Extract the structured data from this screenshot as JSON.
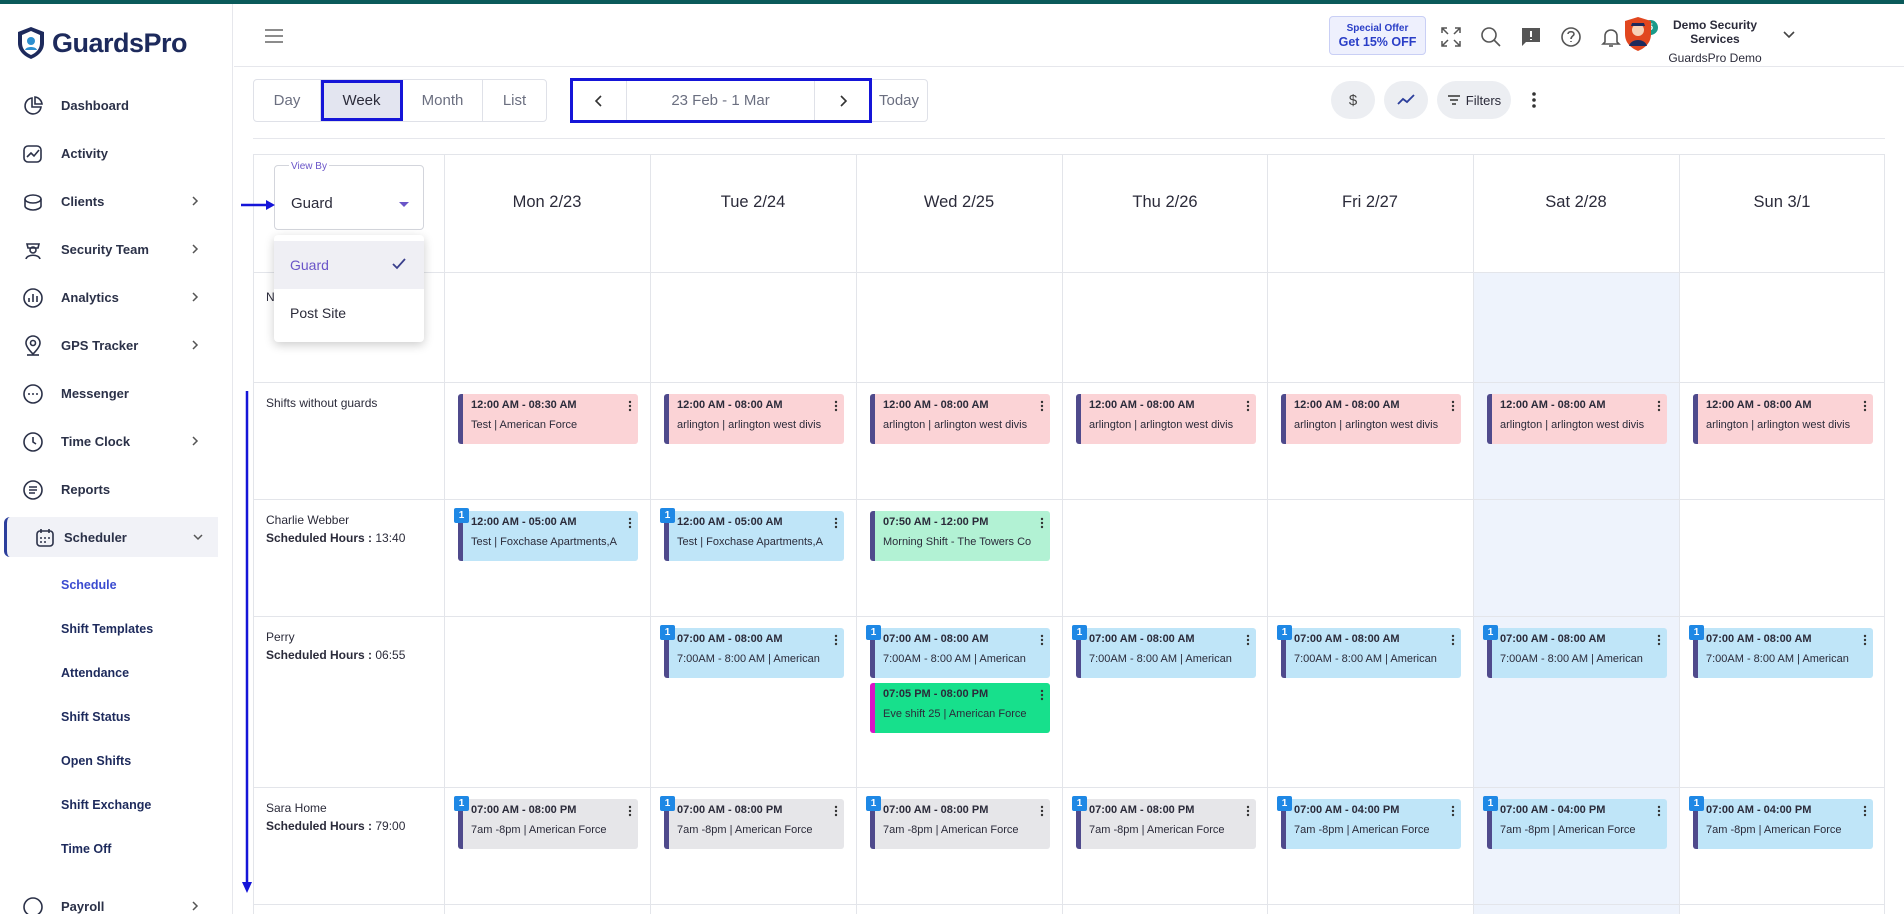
{
  "app": {
    "brand": "GuardsPro"
  },
  "sidebar": {
    "items": [
      {
        "label": "Dashboard"
      },
      {
        "label": "Activity"
      },
      {
        "label": "Clients"
      },
      {
        "label": "Security Team"
      },
      {
        "label": "Analytics"
      },
      {
        "label": "GPS Tracker"
      },
      {
        "label": "Messenger"
      },
      {
        "label": "Time Clock"
      },
      {
        "label": "Reports"
      },
      {
        "label": "Scheduler"
      },
      {
        "label": "Payroll"
      }
    ],
    "scheduler_sub": [
      {
        "label": "Schedule"
      },
      {
        "label": "Shift Templates"
      },
      {
        "label": "Attendance"
      },
      {
        "label": "Shift Status"
      },
      {
        "label": "Open Shifts"
      },
      {
        "label": "Shift Exchange"
      },
      {
        "label": "Time Off"
      }
    ]
  },
  "header": {
    "offer_line1": "Special Offer",
    "offer_line2": "Get 15% OFF",
    "notification_count": "5",
    "company_name": "Demo Security Services",
    "user_name": "GuardsPro Demo"
  },
  "toolbar": {
    "views": [
      "Day",
      "Week",
      "Month",
      "List"
    ],
    "active_view": "Week",
    "date_range": "23 Feb - 1 Mar",
    "today_label": "Today",
    "dollar_label": "$",
    "filters_label": "Filters"
  },
  "view_by": {
    "label": "View By",
    "value": "Guard",
    "options": [
      "Guard",
      "Post Site"
    ]
  },
  "grid": {
    "days": [
      "Mon 2/23",
      "Tue 2/24",
      "Wed 2/25",
      "Thu 2/26",
      "Fri 2/27",
      "Sat 2/28",
      "Sun 3/1"
    ],
    "hidden_row_stub": "N",
    "rows": [
      {
        "name": "Shifts without guards",
        "hours_label": "",
        "hours": ""
      },
      {
        "name": "Charlie Webber",
        "hours_label": "Scheduled Hours :",
        "hours": "13:40"
      },
      {
        "name": "Perry",
        "hours_label": "Scheduled Hours :",
        "hours": "06:55"
      },
      {
        "name": "Sara Home",
        "hours_label": "Scheduled Hours :",
        "hours": "79:00"
      }
    ],
    "shifts": {
      "unassigned": [
        {
          "time": "12:00 AM - 08:30 AM",
          "desc": "Test | American Force"
        },
        {
          "time": "12:00 AM - 08:00 AM",
          "desc": "arlington | arlington west divis"
        },
        {
          "time": "12:00 AM - 08:00 AM",
          "desc": "arlington | arlington west divis"
        },
        {
          "time": "12:00 AM - 08:00 AM",
          "desc": "arlington | arlington west divis"
        },
        {
          "time": "12:00 AM - 08:00 AM",
          "desc": "arlington | arlington west divis"
        },
        {
          "time": "12:00 AM - 08:00 AM",
          "desc": "arlington | arlington west divis"
        },
        {
          "time": "12:00 AM - 08:00 AM",
          "desc": "arlington | arlington west divis"
        }
      ],
      "charlie": [
        {
          "time": "12:00 AM - 05:00 AM",
          "desc": "Test | Foxchase Apartments,A",
          "num": "1"
        },
        {
          "time": "12:00 AM - 05:00 AM",
          "desc": "Test | Foxchase Apartments,A",
          "num": "1"
        },
        {
          "time": "07:50 AM - 12:00 PM",
          "desc": "Morning Shift - The Towers Co"
        }
      ],
      "perry": [
        {
          "time": "07:00 AM - 08:00 AM",
          "desc": "7:00AM - 8:00 AM | American",
          "num": "1"
        },
        {
          "time": "07:00 AM - 08:00 AM",
          "desc": "7:00AM - 8:00 AM | American",
          "num": "1"
        },
        {
          "time": "07:05 PM - 08:00 PM",
          "desc": "Eve shift 25 | American Force"
        },
        {
          "time": "07:00 AM - 08:00 AM",
          "desc": "7:00AM - 8:00 AM | American",
          "num": "1"
        },
        {
          "time": "07:00 AM - 08:00 AM",
          "desc": "7:00AM - 8:00 AM | American",
          "num": "1"
        },
        {
          "time": "07:00 AM - 08:00 AM",
          "desc": "7:00AM - 8:00 AM | American",
          "num": "1"
        },
        {
          "time": "07:00 AM - 08:00 AM",
          "desc": "7:00AM - 8:00 AM | American",
          "num": "1"
        }
      ],
      "sara": [
        {
          "time": "07:00 AM - 08:00 PM",
          "desc": "7am -8pm | American Force",
          "num": "1"
        },
        {
          "time": "07:00 AM - 08:00 PM",
          "desc": "7am -8pm | American Force",
          "num": "1"
        },
        {
          "time": "07:00 AM - 08:00 PM",
          "desc": "7am -8pm | American Force",
          "num": "1"
        },
        {
          "time": "07:00 AM - 08:00 PM",
          "desc": "7am -8pm | American Force",
          "num": "1"
        },
        {
          "time": "07:00 AM - 04:00 PM",
          "desc": "7am -8pm | American Force",
          "num": "1"
        },
        {
          "time": "07:00 AM - 04:00 PM",
          "desc": "7am -8pm | American Force",
          "num": "1"
        },
        {
          "time": "07:00 AM - 04:00 PM",
          "desc": "7am -8pm | American Force",
          "num": "1"
        }
      ]
    }
  },
  "colors": {
    "accent": "#3a4bd0",
    "highlight": "#1515d8",
    "unassigned_shift": "#fbd3d6",
    "assigned_shift": "#bfe5f8",
    "saturday_bg": "#eef3fc"
  }
}
